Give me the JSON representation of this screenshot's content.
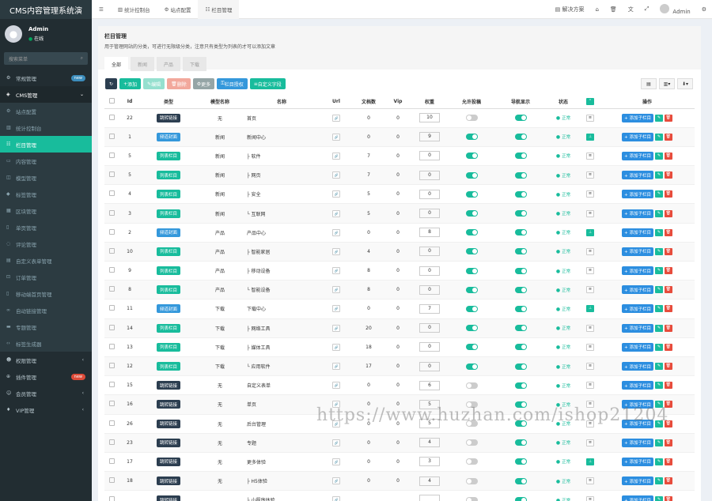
{
  "app_title": "CMS内容管理系统演",
  "user": {
    "name": "Admin",
    "status": "在线"
  },
  "search": {
    "placeholder": "搜索菜单",
    "icon": "search-icon"
  },
  "sidebar": {
    "items": [
      {
        "label": "常规管理",
        "icon": "gear-icon",
        "badge": "new",
        "badge_color": "#3c8dbc",
        "kind": "top"
      },
      {
        "label": "CMS管理",
        "icon": "stack-icon",
        "kind": "parent",
        "arrow": "⌄"
      },
      {
        "label": "站点配置",
        "icon": "gear-icon",
        "kind": "sub"
      },
      {
        "label": "统计控制台",
        "icon": "chart-icon",
        "kind": "sub"
      },
      {
        "label": "栏目管理",
        "icon": "list-icon",
        "kind": "active"
      },
      {
        "label": "内容管理",
        "icon": "file-icon",
        "kind": "sub"
      },
      {
        "label": "模型管理",
        "icon": "cube-icon",
        "kind": "sub"
      },
      {
        "label": "标签管理",
        "icon": "tag-icon",
        "kind": "sub"
      },
      {
        "label": "区块管理",
        "icon": "grid-icon",
        "kind": "sub"
      },
      {
        "label": "单页管理",
        "icon": "page-icon",
        "kind": "sub"
      },
      {
        "label": "评论管理",
        "icon": "comment-icon",
        "kind": "sub"
      },
      {
        "label": "自定义表单管理",
        "icon": "form-icon",
        "kind": "sub"
      },
      {
        "label": "订单管理",
        "icon": "cart-icon",
        "kind": "sub"
      },
      {
        "label": "移动端首页管理",
        "icon": "mobile-icon",
        "kind": "sub"
      },
      {
        "label": "自动链接管理",
        "icon": "link-icon",
        "kind": "sub"
      },
      {
        "label": "专题管理",
        "icon": "folder-icon",
        "kind": "sub"
      },
      {
        "label": "标签生成器",
        "icon": "code-icon",
        "kind": "sub"
      },
      {
        "label": "权限管理",
        "icon": "users-icon",
        "kind": "top",
        "arrow": "‹"
      },
      {
        "label": "插件管理",
        "icon": "plug-icon",
        "kind": "top",
        "badge": "new",
        "badge_color": "#dd4b39"
      },
      {
        "label": "会员管理",
        "icon": "user-icon",
        "kind": "top",
        "arrow": "‹"
      },
      {
        "label": "VIP管理",
        "icon": "vip-icon",
        "kind": "top",
        "arrow": "‹"
      }
    ]
  },
  "topbar": {
    "tabs": [
      {
        "label": "统计控制台",
        "icon": "chart-icon"
      },
      {
        "label": "站点配置",
        "icon": "gear-icon"
      },
      {
        "label": "栏目管理",
        "icon": "list-icon"
      }
    ],
    "solution_label": "解决方案",
    "user_label": "Admin"
  },
  "panel": {
    "title": "栏目管理",
    "desc": "用于管理网站的分类，可进行无限级分类，注意只有类型为列表的才可以添加文章",
    "tabs": [
      "全部",
      "新闻",
      "产品",
      "下载"
    ]
  },
  "toolbar": {
    "buttons": [
      {
        "label": "",
        "icon": "refresh-icon",
        "color": "#2c3e50"
      },
      {
        "label": "添加",
        "icon": "plus-icon",
        "color": "#18bc9c"
      },
      {
        "label": "编辑",
        "icon": "pencil-icon",
        "color": "#95e0cf"
      },
      {
        "label": "删除",
        "icon": "trash-icon",
        "color": "#f2a89c"
      },
      {
        "label": "更多",
        "icon": "cog-icon",
        "color": "#95a5a6"
      },
      {
        "label": "栏目授权",
        "icon": "key-icon",
        "color": "#3498db"
      },
      {
        "label": "自定义字段",
        "icon": "field-icon",
        "color": "#18bc9c"
      }
    ]
  },
  "table": {
    "headers": [
      "",
      "Id",
      "类型",
      "模型名称",
      "名称",
      "Url",
      "文档数",
      "Vip",
      "权重",
      "允许投稿",
      "导航显示",
      "状态",
      "",
      "操作"
    ],
    "add_child_label": "添加子栏目",
    "rows": [
      {
        "id": "22",
        "type": "跳转链接",
        "model": "无",
        "name": "首页",
        "docs": "0",
        "vip": "0",
        "weigh": "10",
        "contribute": false,
        "nav": true,
        "status": "正常",
        "ext": false
      },
      {
        "id": "1",
        "type": "频道封面",
        "model": "新闻",
        "name": "新闻中心",
        "docs": "0",
        "vip": "0",
        "weigh": "9",
        "contribute": true,
        "nav": true,
        "status": "正常",
        "ext": true
      },
      {
        "id": "5",
        "type": "列表栏目",
        "model": "新闻",
        "name": "├ 软件",
        "docs": "7",
        "vip": "0",
        "weigh": "0",
        "contribute": true,
        "nav": true,
        "status": "正常",
        "ext": false
      },
      {
        "id": "5",
        "type": "列表栏目",
        "model": "新闻",
        "name": "├ 网页",
        "docs": "7",
        "vip": "0",
        "weigh": "0",
        "contribute": true,
        "nav": true,
        "status": "正常",
        "ext": false
      },
      {
        "id": "4",
        "type": "列表栏目",
        "model": "新闻",
        "name": "├ 安全",
        "docs": "5",
        "vip": "0",
        "weigh": "0",
        "contribute": true,
        "nav": true,
        "status": "正常",
        "ext": false
      },
      {
        "id": "3",
        "type": "列表栏目",
        "model": "新闻",
        "name": "└ 互联网",
        "docs": "5",
        "vip": "0",
        "weigh": "0",
        "contribute": true,
        "nav": true,
        "status": "正常",
        "ext": false
      },
      {
        "id": "2",
        "type": "频道封面",
        "model": "产品",
        "name": "产品中心",
        "docs": "0",
        "vip": "0",
        "weigh": "8",
        "contribute": true,
        "nav": true,
        "status": "正常",
        "ext": true
      },
      {
        "id": "10",
        "type": "列表栏目",
        "model": "产品",
        "name": "├ 智能家居",
        "docs": "4",
        "vip": "0",
        "weigh": "0",
        "contribute": true,
        "nav": true,
        "status": "正常",
        "ext": false
      },
      {
        "id": "9",
        "type": "列表栏目",
        "model": "产品",
        "name": "├ 移动设备",
        "docs": "8",
        "vip": "0",
        "weigh": "0",
        "contribute": true,
        "nav": true,
        "status": "正常",
        "ext": false
      },
      {
        "id": "8",
        "type": "列表栏目",
        "model": "产品",
        "name": "└ 智能设备",
        "docs": "8",
        "vip": "0",
        "weigh": "0",
        "contribute": true,
        "nav": true,
        "status": "正常",
        "ext": false
      },
      {
        "id": "11",
        "type": "频道封面",
        "model": "下载",
        "name": "下载中心",
        "docs": "0",
        "vip": "0",
        "weigh": "7",
        "contribute": true,
        "nav": true,
        "status": "正常",
        "ext": true
      },
      {
        "id": "14",
        "type": "列表栏目",
        "model": "下载",
        "name": "├ 网络工具",
        "docs": "20",
        "vip": "0",
        "weigh": "0",
        "contribute": true,
        "nav": true,
        "status": "正常",
        "ext": false
      },
      {
        "id": "13",
        "type": "列表栏目",
        "model": "下载",
        "name": "├ 媒体工具",
        "docs": "18",
        "vip": "0",
        "weigh": "0",
        "contribute": true,
        "nav": true,
        "status": "正常",
        "ext": false
      },
      {
        "id": "12",
        "type": "列表栏目",
        "model": "下载",
        "name": "└ 应用软件",
        "docs": "17",
        "vip": "0",
        "weigh": "0",
        "contribute": true,
        "nav": true,
        "status": "正常",
        "ext": false
      },
      {
        "id": "15",
        "type": "跳转链接",
        "model": "无",
        "name": "自定义表单",
        "docs": "0",
        "vip": "0",
        "weigh": "6",
        "contribute": false,
        "nav": true,
        "status": "正常",
        "ext": false
      },
      {
        "id": "16",
        "type": "跳转链接",
        "model": "无",
        "name": "单页",
        "docs": "0",
        "vip": "0",
        "weigh": "5",
        "contribute": false,
        "nav": true,
        "status": "正常",
        "ext": false
      },
      {
        "id": "26",
        "type": "跳转链接",
        "model": "无",
        "name": "后台管理",
        "docs": "0",
        "vip": "0",
        "weigh": "5",
        "contribute": false,
        "nav": true,
        "status": "正常",
        "ext": false
      },
      {
        "id": "23",
        "type": "跳转链接",
        "model": "无",
        "name": "专题",
        "docs": "0",
        "vip": "0",
        "weigh": "4",
        "contribute": false,
        "nav": true,
        "status": "正常",
        "ext": false
      },
      {
        "id": "17",
        "type": "跳转链接",
        "model": "无",
        "name": "更多体验",
        "docs": "0",
        "vip": "0",
        "weigh": "3",
        "contribute": false,
        "nav": true,
        "status": "正常",
        "ext": true
      },
      {
        "id": "18",
        "type": "跳转链接",
        "model": "无",
        "name": "├ H5体验",
        "docs": "0",
        "vip": "0",
        "weigh": "4",
        "contribute": false,
        "nav": true,
        "status": "正常",
        "ext": false
      },
      {
        "id": "",
        "type": "跳转链接",
        "model": "",
        "name": "├ 小程序体验",
        "docs": "",
        "vip": "",
        "weigh": "",
        "contribute": false,
        "nav": true,
        "status": "正常",
        "ext": false
      }
    ]
  },
  "type_colors": {
    "跳转链接": "#2c3e50",
    "频道封面": "#3498db",
    "列表栏目": "#18bc9c"
  },
  "watermark": "https://www.huzhan.com/ishop21204"
}
